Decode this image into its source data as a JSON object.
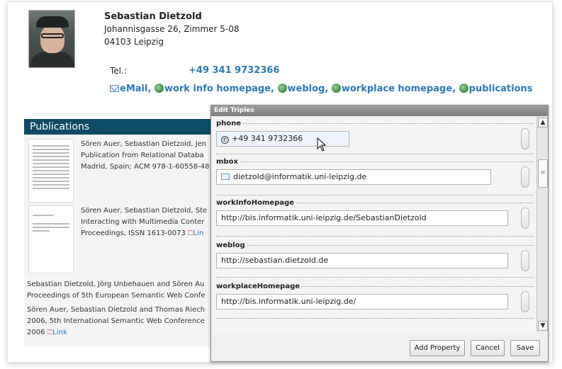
{
  "profile": {
    "name": "Sebastian Dietzold",
    "address_line1": "Johannisgasse 26, Zimmer 5-08",
    "address_line2": "04103 Leipzig",
    "tel_label": "Tel.:",
    "tel_value": "+49 341 9732366",
    "links": {
      "email": "eMail",
      "work_info": "work info homepage",
      "weblog": "weblog",
      "workplace": "workplace homepage",
      "publications": "publications",
      "separator": ","
    }
  },
  "publications": {
    "header": "Publications",
    "entries": [
      {
        "line1": "Sören Auer, Sebastian Dietzold, Jen",
        "line2": "Publication from Relational Databa",
        "line3": "Madrid, Spain; ACM 978-1-60558-48"
      },
      {
        "line1": "Sören Auer, Sebastian Dietzold, Ste",
        "line2": "Interacting with Multimedia Conter",
        "line3": "Proceedings, ISSN 1613-0073",
        "link": "Lin"
      },
      {
        "line1": "Sebastian Dietzold, Jörg Unbehauen and Sören Au",
        "line2": "Proceedings of 5th European Semantic Web Confe"
      },
      {
        "line1": "Sören Auer, Sebastian Dietzold and Thomas Riech",
        "line2": "2006, 5th International Semantic Web Conference",
        "line3": "2006",
        "link": "Link"
      }
    ]
  },
  "dialog": {
    "title": "Edit Triples",
    "properties": [
      {
        "label": "phone",
        "value": "+49 341 9732366"
      },
      {
        "label": "mbox",
        "value": "dietzold@informatik.uni-leipzig.de"
      },
      {
        "label": "workInfoHomepage",
        "value": "http://bis.informatik.uni-leipzig.de/SebastianDietzold"
      },
      {
        "label": "weblog",
        "value": "http://sebastian.dietzold.de"
      },
      {
        "label": "workplaceHomepage",
        "value": "http://bis.informatik.uni-leipzig.de/"
      }
    ],
    "buttons": {
      "add_property": "Add Property",
      "cancel": "Cancel",
      "save": "Save"
    },
    "scroll_up": "▲",
    "scroll_down": "▼",
    "scroll_grip": "≡"
  },
  "colors": {
    "link": "#2a7ab8",
    "pubs_header": "#0e4c66",
    "dialog_title": "#8c8c8c"
  }
}
